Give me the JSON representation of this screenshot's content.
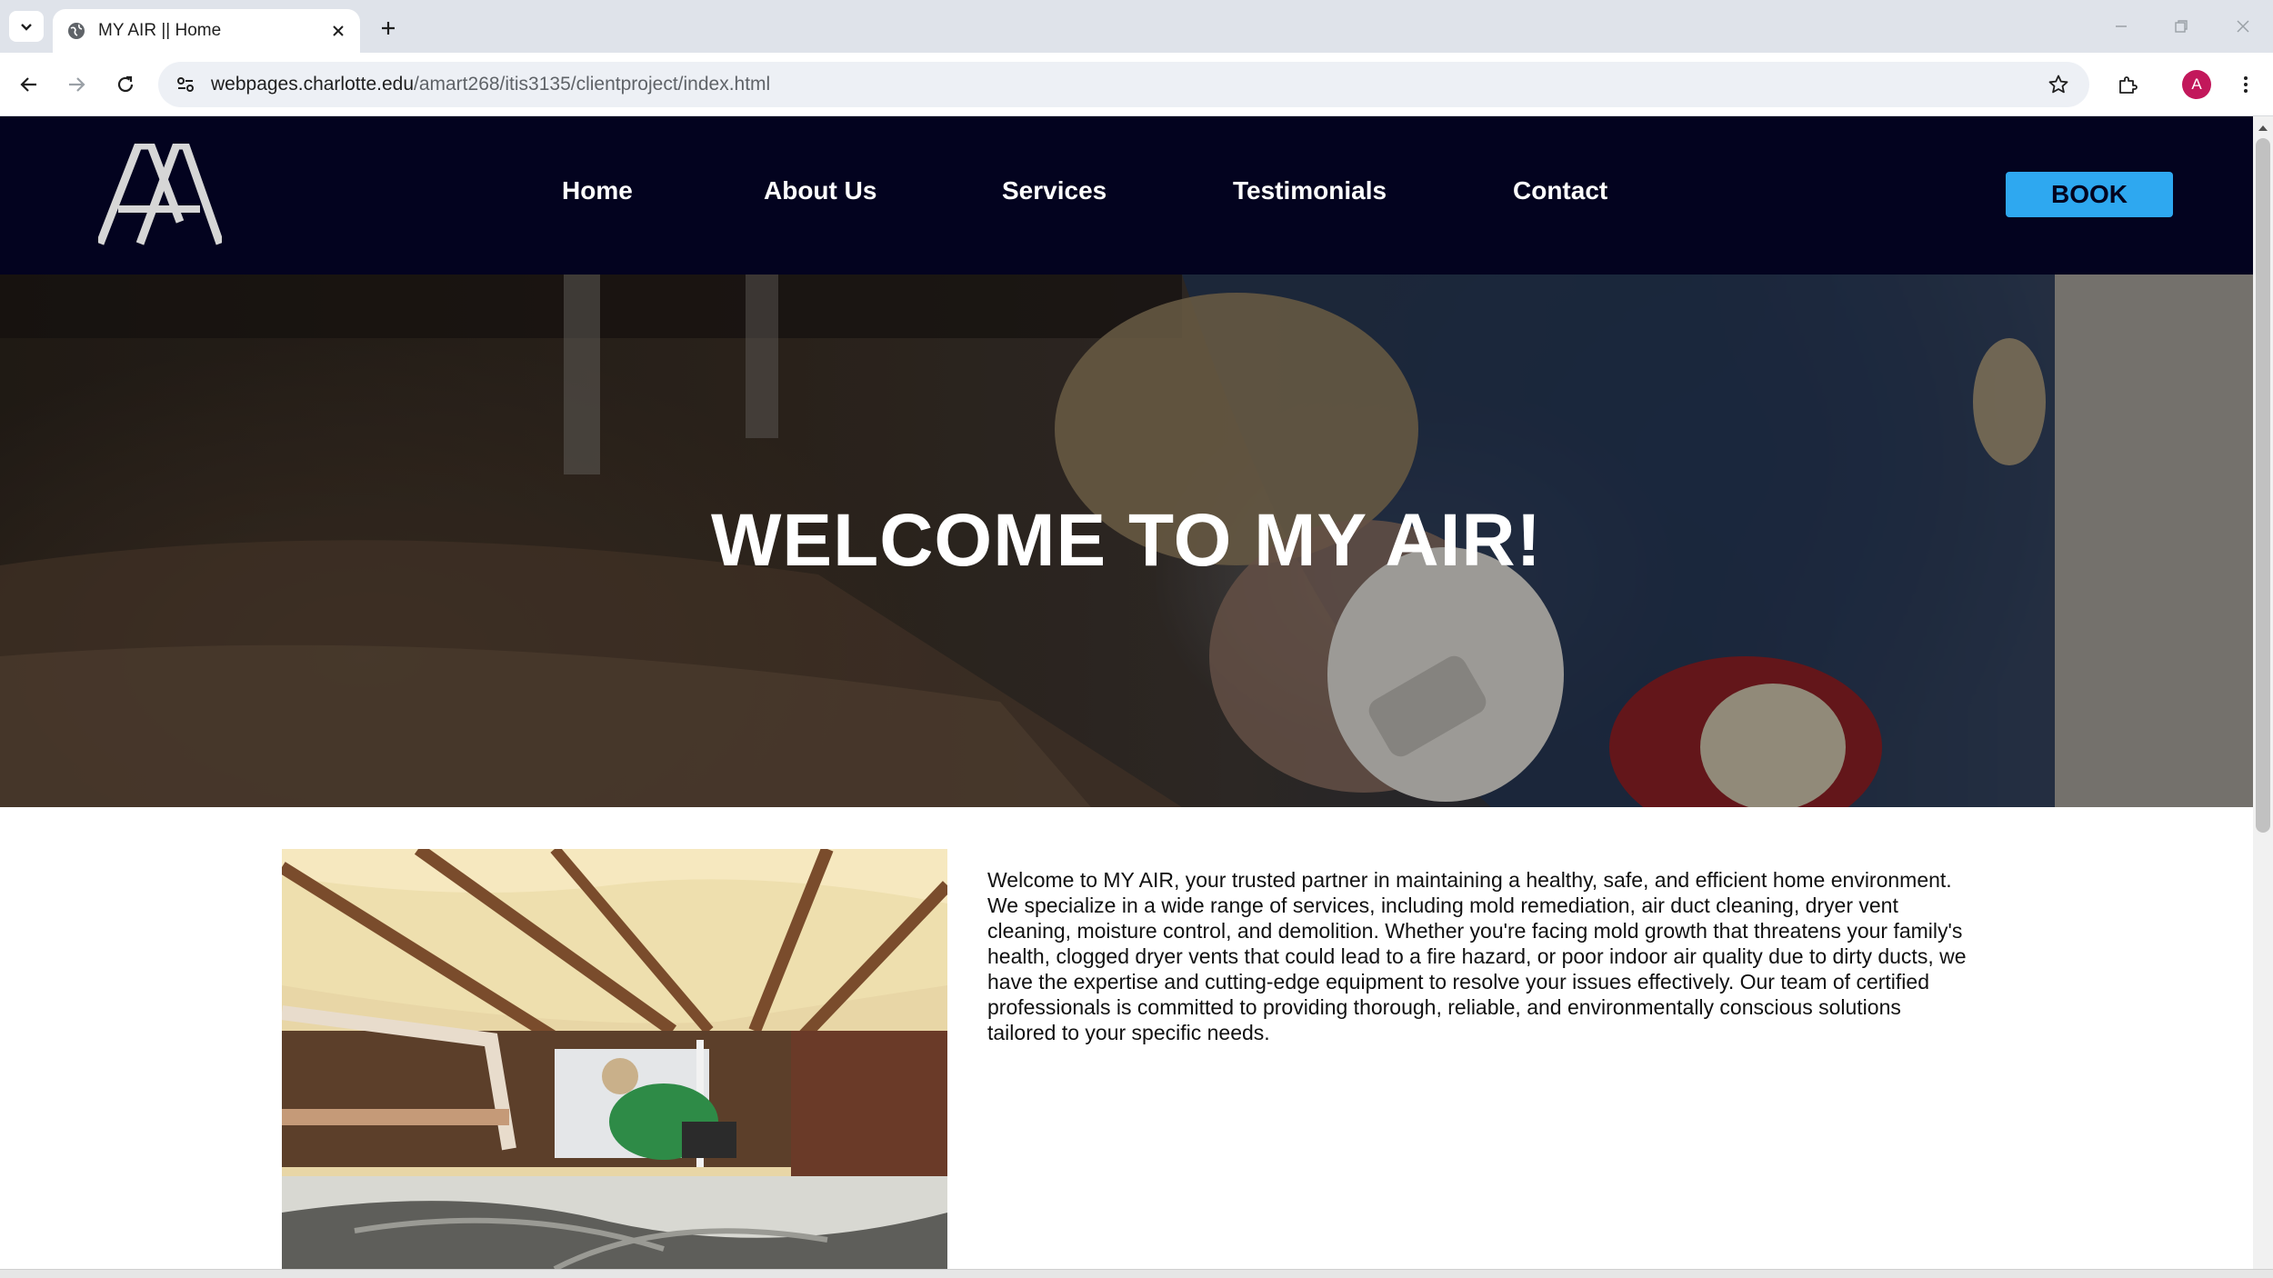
{
  "browser": {
    "tab_title": "MY AIR || Home",
    "url_host": "webpages.charlotte.edu",
    "url_path": "/amart268/itis3135/clientproject/index.html",
    "profile_initial": "A",
    "colors": {
      "tabbar": "#dfe3ea",
      "omnibox": "#edf0f5",
      "profile": "#c2185b"
    }
  },
  "site": {
    "nav": {
      "items": [
        {
          "label": "Home"
        },
        {
          "label": "About Us"
        },
        {
          "label": "Services"
        },
        {
          "label": "Testimonials"
        },
        {
          "label": "Contact"
        }
      ],
      "book_label": "BOOK"
    },
    "hero": {
      "title": "WELCOME TO MY AIR!"
    },
    "intro": {
      "text": "Welcome to MY AIR, your trusted partner in maintaining a healthy, safe, and efficient home environment. We specialize in a wide range of services, including mold remediation, air duct cleaning, dryer vent cleaning, moisture control, and demolition. Whether you're facing mold growth that threatens your family's health, clogged dryer vents that could lead to a fire hazard, or poor indoor air quality due to dirty ducts, we have the expertise and cutting-edge equipment to resolve your issues effectively. Our team of certified professionals is committed to providing thorough, reliable, and environmentally conscious solutions tailored to your specific needs."
    },
    "colors": {
      "nav_bg": "#03031f",
      "book_bg": "#2ea8f0",
      "text": "#111111"
    }
  }
}
